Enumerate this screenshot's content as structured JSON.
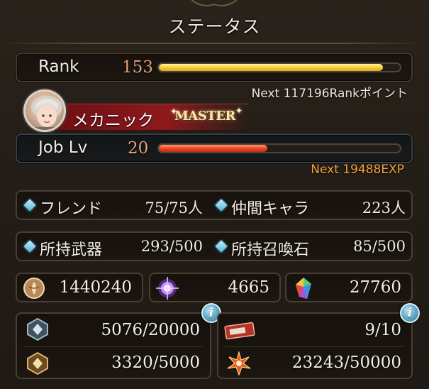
{
  "header": {
    "title": "ステータス",
    "ornament_icon": "ornament-icon"
  },
  "rank": {
    "label": "Rank",
    "value": "153",
    "progress": 0.93,
    "next_text": "Next 117196Rankポイント"
  },
  "job": {
    "name": "メカニック",
    "badge": "MASTER",
    "level_label": "Job Lv",
    "level_value": "20",
    "progress": 0.45,
    "next_text": "Next 19488EXP",
    "avatar_icon": "character-avatar"
  },
  "party": [
    {
      "label": "フレンド",
      "value": "75/75人"
    },
    {
      "label": "仲間キャラ",
      "value": "223人"
    },
    {
      "label": "所持武器",
      "value": "293/500"
    },
    {
      "label": "所持召喚石",
      "value": "85/500"
    }
  ],
  "currencies": [
    {
      "icon": "rupie-coin-icon",
      "value": "1440240"
    },
    {
      "icon": "crystal-orb-icon",
      "value": "4665"
    },
    {
      "icon": "rainbow-crystal-icon",
      "value": "27760"
    }
  ],
  "stamina": {
    "left": [
      {
        "icon": "ap-shield-icon",
        "value": "5076/20000"
      },
      {
        "icon": "bp-shield-icon",
        "value": "3320/5000"
      }
    ],
    "right": [
      {
        "icon": "ticket-icon",
        "value": "9/10"
      },
      {
        "icon": "burst-star-icon",
        "value": "23243/50000"
      }
    ],
    "info_button": "i"
  },
  "colors": {
    "rank_bar": "#f2c52a",
    "job_bar": "#e8442a",
    "next_exp": "#f0a13a",
    "job_banner": "#8d1a1d",
    "info_accent": "#62a9c6"
  }
}
